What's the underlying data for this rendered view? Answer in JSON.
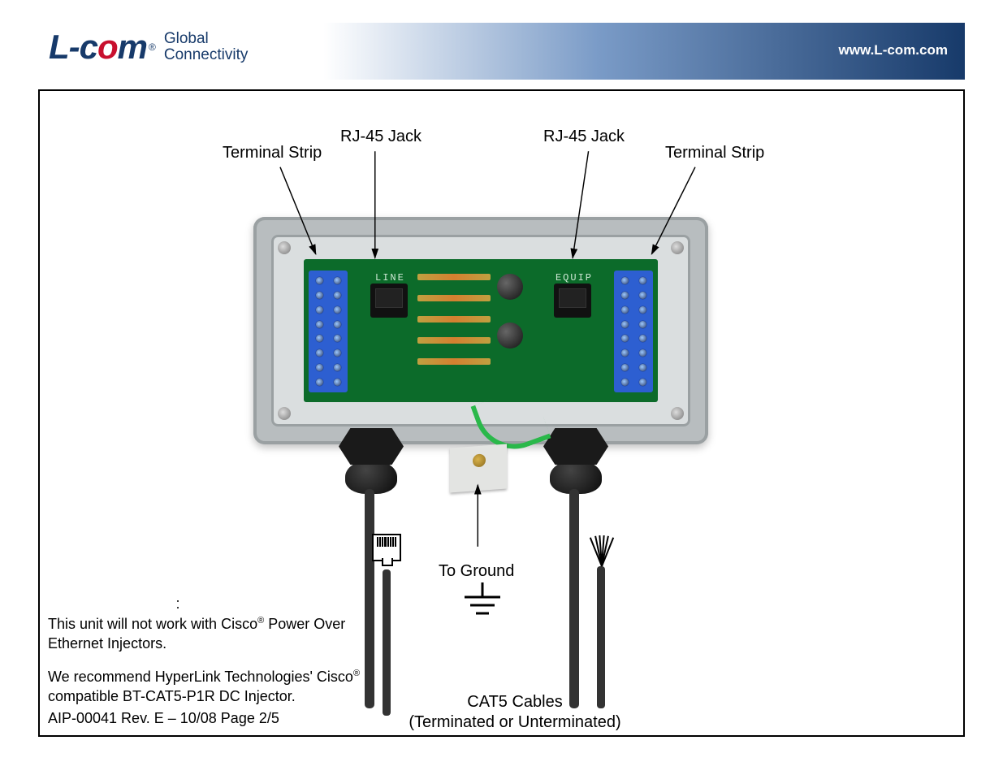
{
  "header": {
    "logo_text_1": "L-c",
    "logo_text_2": "o",
    "logo_text_3": "m",
    "reg": "®",
    "tagline_1": "Global",
    "tagline_2": "Connectivity",
    "url": "www.L-com.com"
  },
  "labels": {
    "terminal_strip_left": "Terminal Strip",
    "rj45_left": "RJ-45 Jack",
    "rj45_right": "RJ-45 Jack",
    "terminal_strip_right": "Terminal Strip",
    "to_ground": "To Ground",
    "cat5_line1": "CAT5 Cables",
    "cat5_line2": "(Terminated or Unterminated)"
  },
  "pcb": {
    "line_label": "LINE",
    "equip_label": "EQUIP"
  },
  "note": {
    "heading": ":",
    "para1_a": "This unit will not work with Cisco",
    "para1_b": " Power Over Ethernet Injectors.",
    "para2_a": "We recommend HyperLink Technologies' Cisco",
    "para2_b": " compatible BT-CAT5-P1R DC Injector.",
    "reg": "®"
  },
  "footer": {
    "text": "AIP-00041 Rev. E – 10/08 Page 2/5"
  }
}
